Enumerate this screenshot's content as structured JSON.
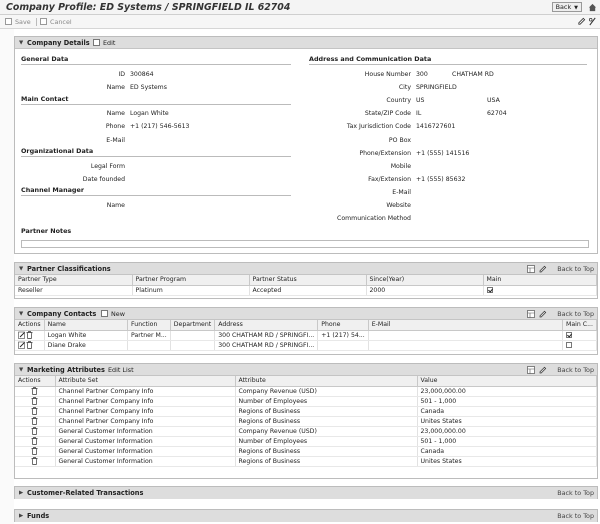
{
  "window": {
    "title": "Company Profile: ED Systems / SPRINGFIELD IL 62704",
    "back_label": "Back"
  },
  "toolbar": {
    "save_label": "Save",
    "cancel_label": "Cancel"
  },
  "company_details": {
    "header": "Company Details",
    "edit_label": "Edit",
    "general_data_title": "General Data",
    "id_label": "ID",
    "id_value": "300864",
    "name_label": "Name",
    "name_value": "ED Systems",
    "main_contact_title": "Main Contact",
    "contact_name_label": "Name",
    "contact_name_value": "Logan White",
    "phone_label": "Phone",
    "phone_value": "+1 (217) 546-5613",
    "email_label": "E-Mail",
    "email_value": "",
    "org_data_title": "Organizational Data",
    "legal_form_label": "Legal Form",
    "legal_form_value": "",
    "date_founded_label": "Date founded",
    "date_founded_value": "",
    "channel_manager_title": "Channel Manager",
    "cm_name_label": "Name",
    "cm_name_value": "",
    "address_title": "Address and Communication Data",
    "house_number_label": "House Number",
    "house_number_value": "300",
    "street_value": "CHATHAM RD",
    "city_label": "City",
    "city_value": "SPRINGFIELD",
    "country_label": "Country",
    "country_code": "US",
    "country_name": "USA",
    "state_zip_label": "State/ZIP Code",
    "state_value": "IL",
    "zip_value": "62704",
    "tax_label": "Tax Jurisdiction Code",
    "tax_value": "1416727601",
    "pobox_label": "PO Box",
    "pobox_value": "",
    "phone_ext_label": "Phone/Extension",
    "phone_ext_value": "+1 (555) 141516",
    "mobile_label": "Mobile",
    "mobile_value": "",
    "fax_ext_label": "Fax/Extension",
    "fax_ext_value": "+1 (555) 85632",
    "email2_label": "E-Mail",
    "email2_value": "",
    "website_label": "Website",
    "website_value": "",
    "comm_method_label": "Communication Method",
    "comm_method_value": "",
    "partner_notes_title": "Partner Notes"
  },
  "partner_classifications": {
    "header": "Partner Classifications",
    "back_to_top": "Back to Top",
    "columns": [
      "Partner Type",
      "Partner Program",
      "Partner Status",
      "Since(Year)",
      "Main"
    ],
    "rows": [
      {
        "type": "Reseller",
        "program": "Platinum",
        "status": "Accepted",
        "since": "2000",
        "main": true
      }
    ]
  },
  "company_contacts": {
    "header": "Company Contacts",
    "new_label": "New",
    "back_to_top": "Back to Top",
    "columns": [
      "Actions",
      "Name",
      "Function",
      "Department",
      "Address",
      "Phone",
      "E-Mail",
      "Main C..."
    ],
    "rows": [
      {
        "name": "Logan White",
        "function": "Partner M...",
        "department": "",
        "address": "300 CHATHAM RD / SPRINGFI...",
        "phone": "+1 (217) 54...",
        "email": "",
        "main": true
      },
      {
        "name": "Diane Drake",
        "function": "",
        "department": "",
        "address": "300 CHATHAM RD / SPRINGFI...",
        "phone": "",
        "email": "",
        "main": false
      }
    ]
  },
  "marketing_attributes": {
    "header": "Marketing Attributes",
    "edit_list_label": "Edit List",
    "back_to_top": "Back to Top",
    "columns": [
      "Actions",
      "Attribute Set",
      "Attribute",
      "Value"
    ],
    "rows": [
      {
        "set": "Channel Partner Company Info",
        "attribute": "Company Revenue (USD)",
        "value": "23,000,000.00"
      },
      {
        "set": "Channel Partner Company Info",
        "attribute": "Number of Employees",
        "value": "501 - 1,000"
      },
      {
        "set": "Channel Partner Company Info",
        "attribute": "Regions of Business",
        "value": "Canada"
      },
      {
        "set": "Channel Partner Company Info",
        "attribute": "Regions of Business",
        "value": "Unites States"
      },
      {
        "set": "General Customer Information",
        "attribute": "Company Revenue (USD)",
        "value": "23,000,000.00"
      },
      {
        "set": "General Customer Information",
        "attribute": "Number of Employees",
        "value": "501 - 1,000"
      },
      {
        "set": "General Customer Information",
        "attribute": "Regions of Business",
        "value": "Canada"
      },
      {
        "set": "General Customer Information",
        "attribute": "Regions of Business",
        "value": "Unites States"
      }
    ]
  },
  "customer_transactions": {
    "header": "Customer-Related Transactions",
    "back_to_top": "Back to Top"
  },
  "funds": {
    "header": "Funds",
    "back_to_top": "Back to Top"
  }
}
